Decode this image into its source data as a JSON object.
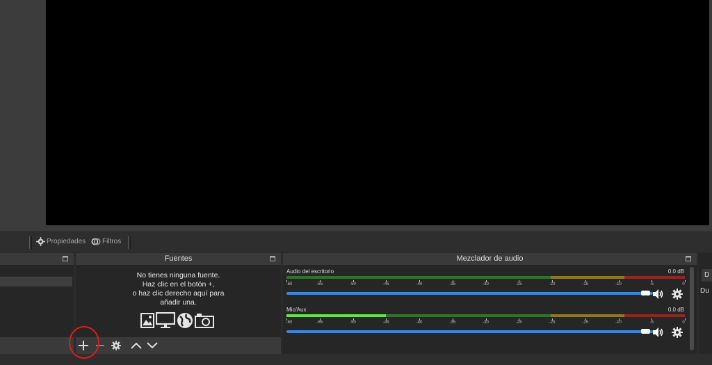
{
  "toolbar": {
    "properties_label": "Propiedades",
    "filters_label": "Filtros"
  },
  "docks": {
    "sources": {
      "title": "Fuentes",
      "empty_lines": [
        "No tienes ninguna fuente.",
        "Haz clic en el botón +,",
        "o haz clic derecho aquí para",
        "añadir una."
      ],
      "source_type_icons": [
        "image-icon",
        "display-icon",
        "browser-icon",
        "camera-icon"
      ],
      "toolbar_icons": [
        "add-icon",
        "remove-icon",
        "gear-icon",
        "up-arrow-icon",
        "down-arrow-icon"
      ]
    },
    "mixer": {
      "title": "Mezclador de audio",
      "channels": [
        {
          "name": "Audio del escritorio",
          "db": "0.0 dB",
          "level": 0.0
        },
        {
          "name": "Mic/Aux",
          "db": "0.0 dB",
          "level": 0.25
        }
      ],
      "ticks": [
        "-60",
        "-55",
        "-50",
        "-45",
        "-40",
        "-35",
        "-30",
        "-25",
        "-20",
        "-15",
        "-10",
        "-5",
        "0"
      ]
    },
    "right": {
      "button_label": "D",
      "label": "Du"
    }
  },
  "colors": {
    "meter_green": "#35702e",
    "meter_yellow": "#8a7a26",
    "meter_red": "#8a2a26",
    "volume_blue": "#3d86d6",
    "highlight_red": "#e21b1b"
  }
}
